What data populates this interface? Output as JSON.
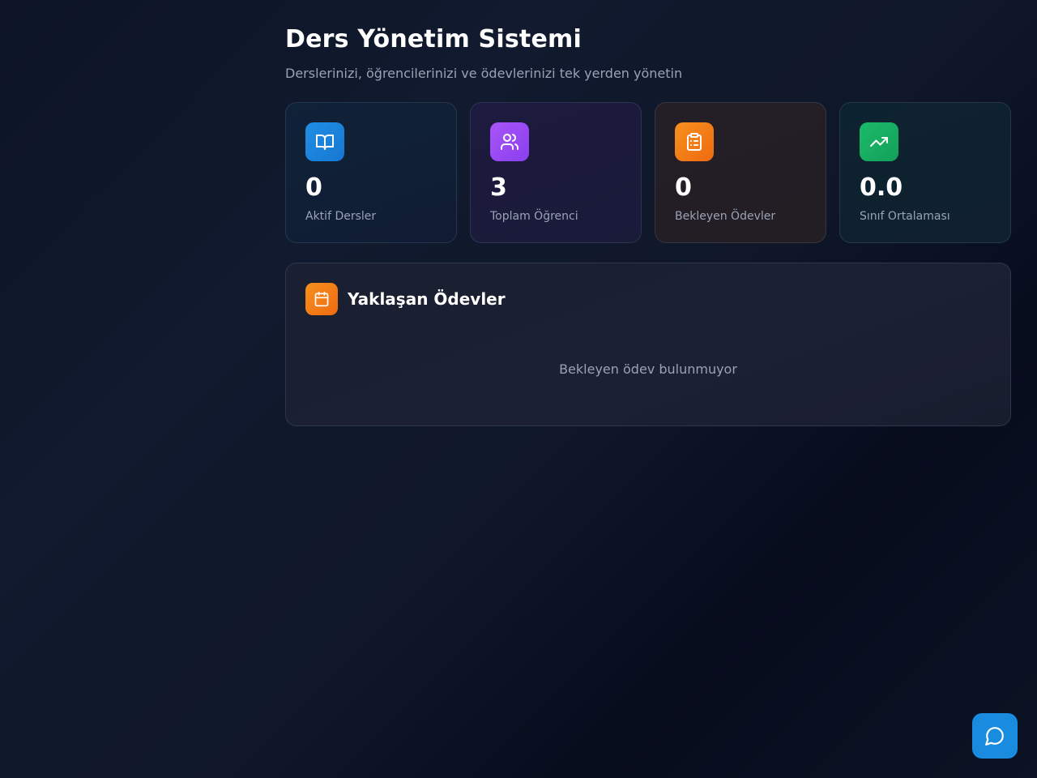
{
  "header": {
    "title": "Ders Yönetim Sistemi",
    "subtitle": "Derslerinizi, öğrencilerinizi ve ödevlerinizi tek yerden yönetin"
  },
  "stats": [
    {
      "value": "0",
      "label": "Aktif Dersler",
      "icon": "book-open-icon",
      "color": "#1f8fe3"
    },
    {
      "value": "3",
      "label": "Toplam Öğrenci",
      "icon": "users-icon",
      "color": "#a855f7"
    },
    {
      "value": "0",
      "label": "Bekleyen Ödevler",
      "icon": "clipboard-list-icon",
      "color": "#f7901e"
    },
    {
      "value": "0.0",
      "label": "Sınıf Ortalaması",
      "icon": "trending-up-icon",
      "color": "#1cbb6a"
    }
  ],
  "upcoming": {
    "title": "Yaklaşan Ödevler",
    "icon": "calendar-icon",
    "empty_text": "Bekleyen ödev bulunmuyor"
  },
  "chat": {
    "icon": "message-circle-icon",
    "color": "#1a8ce0"
  }
}
